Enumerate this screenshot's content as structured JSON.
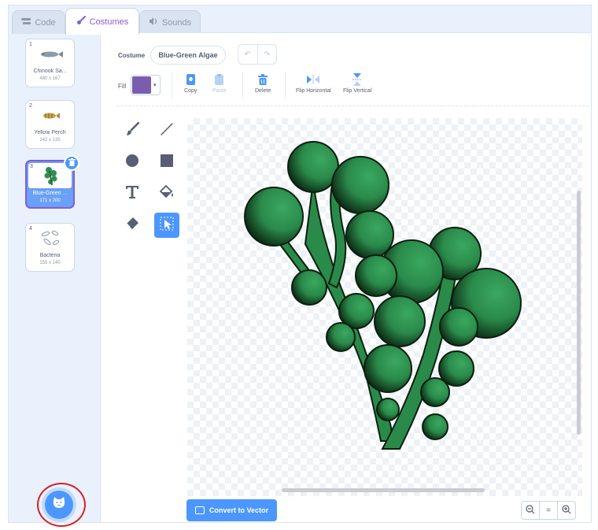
{
  "tabs": [
    {
      "label": "Code",
      "icon": "code-icon"
    },
    {
      "label": "Costumes",
      "icon": "brush-icon"
    },
    {
      "label": "Sounds",
      "icon": "speaker-icon"
    }
  ],
  "costumes": [
    {
      "num": "1",
      "name": "Chinook Sa...",
      "size": "480 x 167"
    },
    {
      "num": "2",
      "name": "Yellow Perch",
      "size": "142 x 135"
    },
    {
      "num": "3",
      "name": "Blue-Green ...",
      "size": "171 x 200"
    },
    {
      "num": "4",
      "name": "Bacteria",
      "size": "155 x 140"
    }
  ],
  "editor": {
    "costume_label": "Costume",
    "costume_name": "Blue-Green Algae",
    "fill_label": "Fill",
    "fill_color": "#7b5db0",
    "actions": {
      "copy": "Copy",
      "paste": "Paste",
      "delete": "Delete",
      "flip_h": "Flip Horizontal",
      "flip_v": "Flip Vertical"
    },
    "convert_label": "Convert to Vector",
    "zoom": {
      "out": "−",
      "reset": "=",
      "in": "+"
    }
  },
  "colors": {
    "accent": "#4c97ff",
    "purple": "#855cd6",
    "algae": "#2f8f4e",
    "highlight_ring": "#d92020"
  }
}
